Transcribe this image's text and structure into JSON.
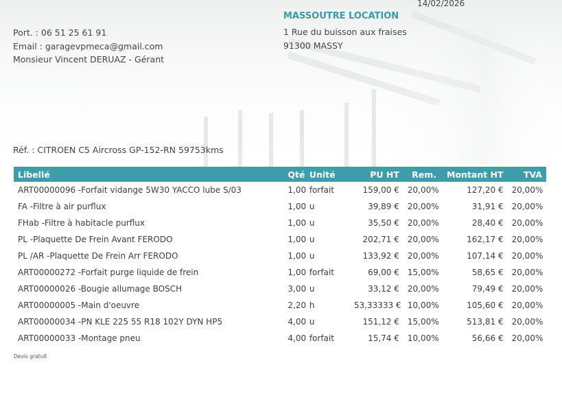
{
  "document": {
    "date": "14/02/2026",
    "sender": {
      "phone": "Port. : 06 51 25 61 91",
      "email": "Email : garagevpmeca@gmail.com",
      "manager": "Monsieur Vincent DERUAZ - Gérant"
    },
    "client": {
      "name": "MASSOUTRE LOCATION",
      "address_line1": "1 Rue du buisson aux fraises",
      "address_line2": "91300 MASSY"
    },
    "reference": "Réf. : CITROEN C5 Aircross GP-152-RN 59753kms",
    "footer_note": "Devis gratuit"
  },
  "table": {
    "headers": [
      "Libellé",
      "Qté",
      "Unité",
      "PU HT",
      "Rem.",
      "Montant HT",
      "TVA"
    ],
    "rows": [
      [
        "ART00000096 -Forfait vidange 5W30 YACCO lube S/03",
        "1,00",
        "forfait",
        "159,00 €",
        "20,00%",
        "127,20 €",
        "20,00%"
      ],
      [
        "FA -Filtre à air purflux",
        "1,00",
        "u",
        "39,89 €",
        "20,00%",
        "31,91 €",
        "20,00%"
      ],
      [
        "FHab -Filtre à habitacle purflux",
        "1,00",
        "u",
        "35,50 €",
        "20,00%",
        "28,40 €",
        "20,00%"
      ],
      [
        "PL -Plaquette De Frein Avant FERODO",
        "1,00",
        "u",
        "202,71 €",
        "20,00%",
        "162,17 €",
        "20,00%"
      ],
      [
        "PL /AR -Plaquette De Frein Arr FERODO",
        "1,00",
        "u",
        "133,92 €",
        "20,00%",
        "107,14 €",
        "20,00%"
      ],
      [
        "ART00000272 -Forfait purge liquide de frein",
        "1,00",
        "forfait",
        "69,00 €",
        "15,00%",
        "58,65 €",
        "20,00%"
      ],
      [
        "ART00000026 -Bougie allumage BOSCH",
        "3,00",
        "u",
        "33,12 €",
        "20,00%",
        "79,49 €",
        "20,00%"
      ],
      [
        "ART00000005 -Main d'oeuvre",
        "2,20",
        "h",
        "53,33333 €",
        "10,00%",
        "105,60 €",
        "20,00%"
      ],
      [
        "ART00000034 -PN KLE 225 55 R18 102Y DYN HP5",
        "4,00",
        "u",
        "151,12 €",
        "15,00%",
        "513,81 €",
        "20,00%"
      ],
      [
        "ART00000033 -Montage pneu",
        "4,00",
        "forfait",
        "15,74 €",
        "10,00%",
        "56,66 €",
        "20,00%"
      ]
    ]
  },
  "colors": {
    "accent": "#3e9daa",
    "client_name": "#3a9aa8"
  }
}
